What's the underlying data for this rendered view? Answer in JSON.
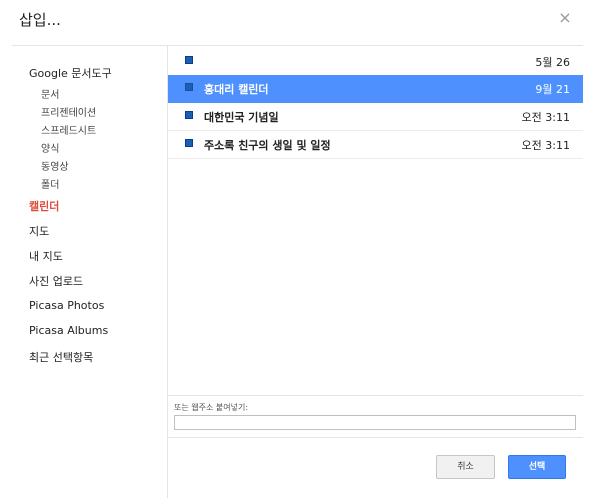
{
  "dialog": {
    "title": "삽입...",
    "close_glyph": "×"
  },
  "sidebar": {
    "items": [
      {
        "label": "Google 문서도구"
      },
      {
        "label": "문서"
      },
      {
        "label": "프리젠테이션"
      },
      {
        "label": "스프레드시트"
      },
      {
        "label": "양식"
      },
      {
        "label": "동영상"
      },
      {
        "label": "폴더"
      },
      {
        "label": "캘린더"
      },
      {
        "label": "지도"
      },
      {
        "label": "내 지도"
      },
      {
        "label": "사진 업로드"
      },
      {
        "label": "Picasa Photos"
      },
      {
        "label": "Picasa Albums"
      },
      {
        "label": "최근 선택항목"
      }
    ]
  },
  "list": {
    "rows": [
      {
        "name": "",
        "date": "5월 26"
      },
      {
        "name": "홍대리 캘린더",
        "date": "9월 21"
      },
      {
        "name": "대한민국 기념일",
        "date": "오전 3:11"
      },
      {
        "name": "주소록 친구의 생일 및 일정",
        "date": "오전 3:11"
      }
    ],
    "square_color": "#1a5fb4",
    "selected_color": "#4d90fe"
  },
  "url": {
    "label": "또는 웹주소 붙여넣기:",
    "value": ""
  },
  "buttons": {
    "cancel": "취소",
    "select": "선택"
  },
  "colors": {
    "accent": "#4d90fe",
    "active_nav": "#dd4b39"
  }
}
